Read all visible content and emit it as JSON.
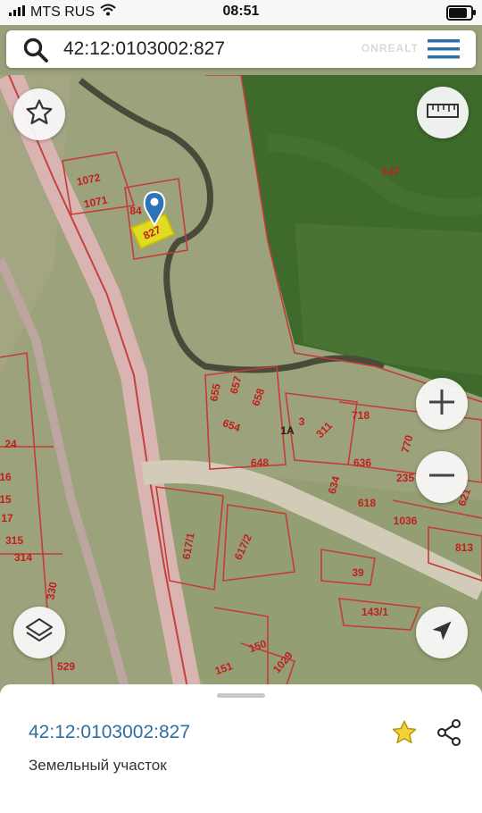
{
  "status_bar": {
    "carrier": "MTS RUS",
    "time": "08:51",
    "battery_level": 0.9
  },
  "search": {
    "query": "42:12:0103002:827",
    "watermark": "ONREALT"
  },
  "map": {
    "parcel_labels": {
      "p1072": "1072",
      "p1071": "1071",
      "p84": "84",
      "p827": "827",
      "p147": "147",
      "p655": "655",
      "p657": "657",
      "p658": "658",
      "p654": "654",
      "p1a": "1А",
      "p3": "3",
      "p311": "311",
      "p718": "718",
      "p770": "770",
      "p636": "636",
      "p648": "648",
      "p235": "235",
      "p634": "634",
      "p618": "618",
      "p1036": "1036",
      "p621": "621",
      "p813": "813",
      "p617_1": "617/1",
      "p617_2": "617/2",
      "p39": "39",
      "p143_1": "143/1",
      "p150": "150",
      "p151": "151",
      "p1029": "1029",
      "p24": "24",
      "p16": "16",
      "p15": "15",
      "p17": "17",
      "p315": "315",
      "p314": "314",
      "p330": "330",
      "p529": "529"
    },
    "selected_parcel": "827",
    "controls": {
      "favorite_icon": "star-outline-icon",
      "ruler_icon": "ruler-icon",
      "zoom_in_icon": "plus-icon",
      "zoom_out_icon": "minus-icon",
      "layers_icon": "layers-icon",
      "locate_icon": "navigation-arrow-icon"
    }
  },
  "sheet": {
    "title": "42:12:0103002:827",
    "subtitle": "Земельный участок",
    "favorite_icon": "star-filled-icon",
    "share_icon": "share-icon"
  },
  "colors": {
    "accent": "#2e6f9e",
    "parcel_border": "#c63a3a",
    "selected_parcel": "#e8e21a",
    "star_fill": "#f2d23a"
  }
}
